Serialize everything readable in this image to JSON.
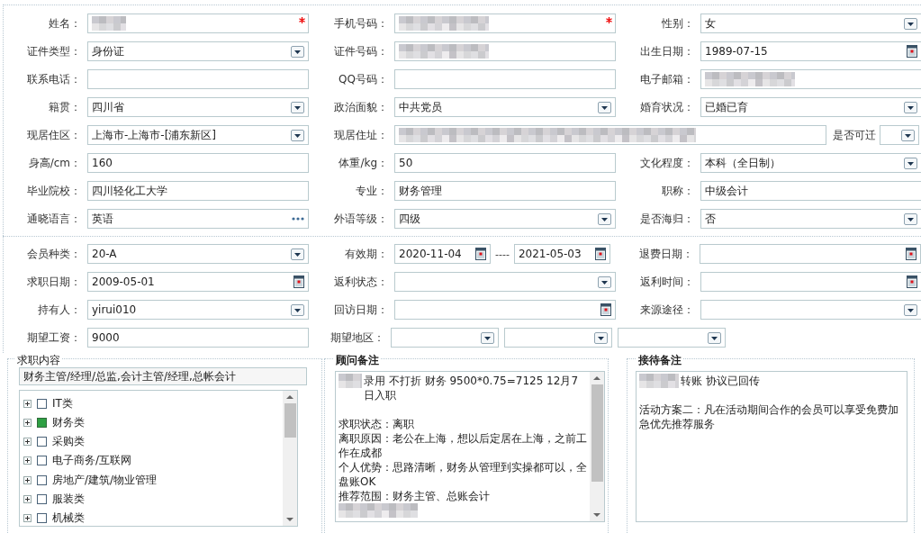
{
  "personal": {
    "rows": [
      [
        {
          "label": "姓名：",
          "kind": "text",
          "required": true,
          "redacted": true
        },
        {
          "label": "手机号码：",
          "kind": "text",
          "required": true,
          "redacted": true
        },
        {
          "label": "性别：",
          "kind": "select",
          "value": "女"
        }
      ],
      [
        {
          "label": "证件类型：",
          "kind": "select",
          "value": "身份证"
        },
        {
          "label": "证件号码：",
          "kind": "text",
          "redacted": true
        },
        {
          "label": "出生日期：",
          "kind": "date",
          "value": "1989-07-15"
        }
      ],
      [
        {
          "label": "联系电话：",
          "kind": "text"
        },
        {
          "label": "QQ号码：",
          "kind": "text"
        },
        {
          "label": "电子邮箱：",
          "kind": "text",
          "redacted": true
        }
      ],
      [
        {
          "label": "籍贯：",
          "kind": "select",
          "value": "四川省"
        },
        {
          "label": "政治面貌：",
          "kind": "select",
          "value": "中共党员"
        },
        {
          "label": "婚育状况：",
          "kind": "select",
          "value": "已婚已育"
        }
      ],
      [
        {
          "label": "现居住区：",
          "kind": "select",
          "value": "上海市-上海市-[浦东新区]"
        },
        {
          "label": "现居住址：",
          "kind": "wide_text",
          "redacted": true
        },
        {
          "label": "是否可迁",
          "kind": "narrow_select"
        }
      ],
      [
        {
          "label": "身高/cm：",
          "kind": "text",
          "value": "160"
        },
        {
          "label": "体重/kg：",
          "kind": "text",
          "value": "50"
        },
        {
          "label": "文化程度：",
          "kind": "select",
          "value": "本科（全日制）"
        }
      ],
      [
        {
          "label": "毕业院校：",
          "kind": "text",
          "value": "四川轻化工大学"
        },
        {
          "label": "专业：",
          "kind": "text",
          "value": "财务管理"
        },
        {
          "label": "职称：",
          "kind": "text",
          "value": "中级会计"
        }
      ],
      [
        {
          "label": "通晓语言：",
          "kind": "lookup",
          "value": "英语"
        },
        {
          "label": "外语等级：",
          "kind": "select",
          "value": "四级"
        },
        {
          "label": "是否海归：",
          "kind": "select",
          "value": "否"
        }
      ]
    ]
  },
  "membership": {
    "rows": [
      [
        {
          "label": "会员种类：",
          "kind": "select",
          "value": "20-A"
        },
        {
          "label": "有效期：",
          "kind": "date_range",
          "from": "2020-11-04",
          "separator": "----",
          "to": "2021-05-03"
        },
        {
          "label": "退费日期：",
          "kind": "date"
        }
      ],
      [
        {
          "label": "求职日期：",
          "kind": "date",
          "value": "2009-05-01"
        },
        {
          "label": "返利状态：",
          "kind": "select"
        },
        {
          "label": "返利时间：",
          "kind": "date"
        }
      ],
      [
        {
          "label": "持有人：",
          "kind": "select",
          "value": "yirui010"
        },
        {
          "label": "回访日期：",
          "kind": "date"
        },
        {
          "label": "来源途径：",
          "kind": "select"
        }
      ],
      [
        {
          "label": "期望工资：",
          "kind": "text",
          "value": "9000"
        },
        {
          "label": "期望地区：",
          "kind": "triple_select"
        }
      ]
    ]
  },
  "job_intent": {
    "legend": "求职内容",
    "emphasis": false,
    "value": "财务主管/经理/总监,会计主管/经理,总帐会计",
    "categories": [
      {
        "label": "IT类",
        "checked": false
      },
      {
        "label": "财务类",
        "checked": true
      },
      {
        "label": "采购类",
        "checked": false
      },
      {
        "label": "电子商务/互联网",
        "checked": false
      },
      {
        "label": "房地产/建筑/物业管理",
        "checked": false
      },
      {
        "label": "服装类",
        "checked": false
      },
      {
        "label": "机械类",
        "checked": false
      }
    ]
  },
  "advisor_notes": {
    "legend": "顾问备注",
    "emphasis": true,
    "lines": [
      {
        "kind": "redacted_text",
        "text": "录用  不打折  财务   9500*0.75=7125   12月7日入职"
      },
      {
        "kind": "blank"
      },
      {
        "kind": "text",
        "text": "求职状态：离职"
      },
      {
        "kind": "text",
        "text": "离职原因：老公在上海，想以后定居在上海，之前工作在成都"
      },
      {
        "kind": "text",
        "text": "个人优势：思路清晰，财务从管理到实操都可以，全盘账OK"
      },
      {
        "kind": "text",
        "text": "推荐范围：财务主管、总账会计"
      },
      {
        "kind": "redacted"
      }
    ]
  },
  "reception_notes": {
    "legend": "接待备注",
    "emphasis": true,
    "lines": [
      {
        "kind": "redacted_text",
        "text": "转账  协议已回传"
      },
      {
        "kind": "blank"
      },
      {
        "kind": "text",
        "text": "活动方案二：凡在活动期间合作的会员可以享受免费加急优先推荐服务"
      }
    ]
  }
}
